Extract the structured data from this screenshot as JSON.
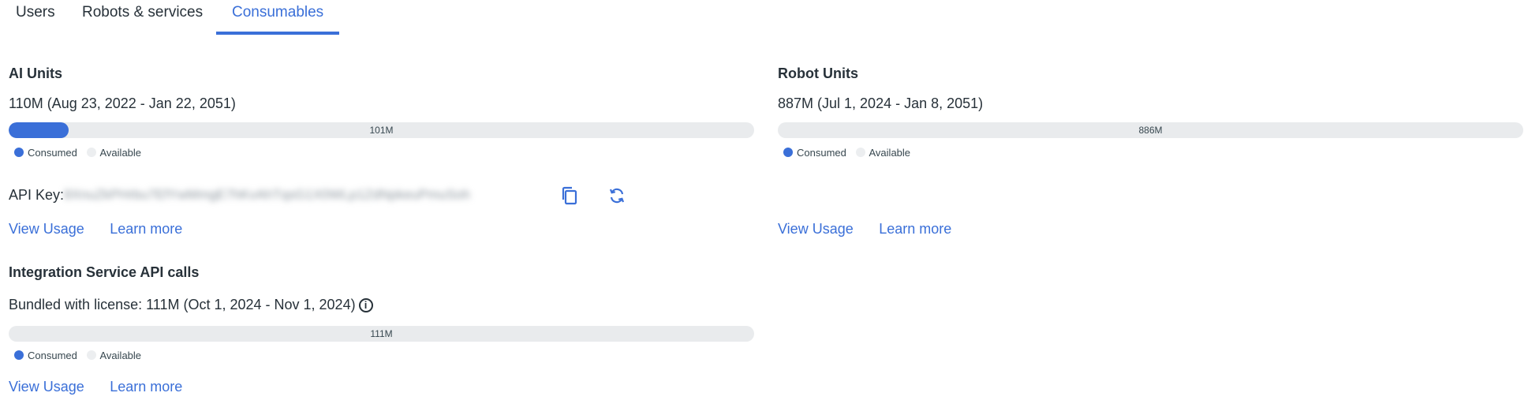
{
  "tabs": [
    {
      "label": "Users",
      "active": false
    },
    {
      "label": "Robots & services",
      "active": false
    },
    {
      "label": "Consumables",
      "active": true
    }
  ],
  "colors": {
    "accent": "#3a6fd8",
    "track": "#e9ebed",
    "text": "#273139"
  },
  "ai_units": {
    "title": "AI Units",
    "quota": "110M (Aug 23, 2022 - Jan 22, 2051)",
    "progress_label": "101M",
    "consumed_fraction": 0.08,
    "legend_consumed": "Consumed",
    "legend_available": "Available",
    "api_key_label": "API Key:",
    "api_key_value": "8XnuZkPHrbu7EfYwMmgE7hKvAhTqsG1X0WLp1ZdNpkeuPmuSoh",
    "copy_icon": "copy-icon",
    "regenerate_icon": "refresh-icon",
    "view_usage": "View Usage",
    "learn_more": "Learn more"
  },
  "robot_units": {
    "title": "Robot Units",
    "quota": "887M (Jul 1, 2024 - Jan 8, 2051)",
    "progress_label": "886M",
    "consumed_fraction": 0.0,
    "legend_consumed": "Consumed",
    "legend_available": "Available",
    "view_usage": "View Usage",
    "learn_more": "Learn more"
  },
  "integration_service": {
    "title": "Integration Service API calls",
    "quota": "Bundled with license: 111M (Oct 1, 2024 - Nov 1, 2024)",
    "info_icon": "info-icon",
    "progress_label": "111M",
    "consumed_fraction": 0.0,
    "legend_consumed": "Consumed",
    "legend_available": "Available",
    "view_usage": "View Usage",
    "learn_more": "Learn more"
  }
}
